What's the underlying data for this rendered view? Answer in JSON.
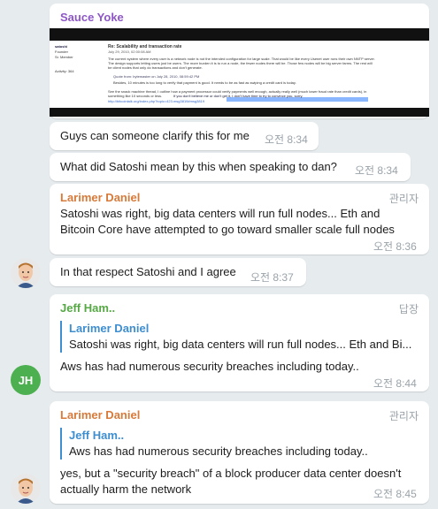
{
  "messages": {
    "m1": {
      "sender": "Sauce Yoke",
      "image_alt": "Screenshot of forum post",
      "forum": {
        "author": "satoshi",
        "role": "Founder",
        "member": "Sr. Member",
        "activity": "Activity: 364",
        "title": "Re: Scalability and transaction rate",
        "date": "July 29, 2010, 02:00:08 AM",
        "body1": "The current system where every user is a network node is not the intended configuration for large scale. That would be like every Usenet user runs their own NNTP server.",
        "body2": "The design supports letting users just be users. The more burden it is to run a node, the fewer nodes there will be. Those few nodes will be big server farms. The rest will",
        "body3": "be client nodes that only do transactions and don't generate.",
        "quote": "Quote from: bytemaster on July 28, 2010, 08:59:42 PM",
        "quote_body": "Besides, 10 minutes is too long to verify that payment is good. It needs to be as fast as swiping a credit card is today.",
        "body4": "See the snack machine thread, I outline how a payment processor could verify payments well enough, actually really well (much lower fraud rate than credit cards), in",
        "body5": "something like 10 seconds or less.",
        "highlight": "If you don't believe me or don't get it, I don't have time to try to convince you, sorry.",
        "link": "http://bitcointalk.org/index.php?topic=423.msg3819#msg3819"
      }
    },
    "m2": {
      "text": "Guys can someone clarify this for me",
      "time": "오전 8:34"
    },
    "m3": {
      "text": "What did Satoshi mean by this when speaking to dan?",
      "time": "오전 8:34"
    },
    "m4": {
      "sender": "Larimer Daniel",
      "role": "관리자",
      "text1": "Satoshi was right, big data centers will run full nodes... Eth and",
      "text2": "Bitcoin Core have attempted to go toward smaller scale full nodes",
      "time": "오전 8:36"
    },
    "m5": {
      "text": "In that respect Satoshi and I agree",
      "time": "오전 8:37"
    },
    "m6": {
      "sender": "Jeff Ham..",
      "role": "답장",
      "avatar_initials": "JH",
      "quote_name": "Larimer Daniel",
      "quote_text": "Satoshi was right, big data centers will run full nodes... Eth and Bi...",
      "text": "Aws has had numerous security breaches including today..",
      "time": "오전 8:44"
    },
    "m7": {
      "sender": "Larimer Daniel",
      "role": "관리자",
      "quote_name": "Jeff Ham..",
      "quote_text": "Aws has had numerous security breaches including today..",
      "text1": "yes, but a \"security breach\" of a block producer data center doesn't",
      "text2": "actually harm the network",
      "time": "오전 8:45"
    }
  },
  "colors": {
    "sauce_yoke": "#8e57c7",
    "larimer": "#d77a3a",
    "jeff": "#56a845",
    "quote_bar": "#3e8ed0",
    "background": "#e6ebee",
    "time": "#9aa3aa"
  },
  "icons": {
    "avatar_larimer": "cartoon-man-avatar-icon",
    "avatar_jeff": "initials-avatar"
  }
}
